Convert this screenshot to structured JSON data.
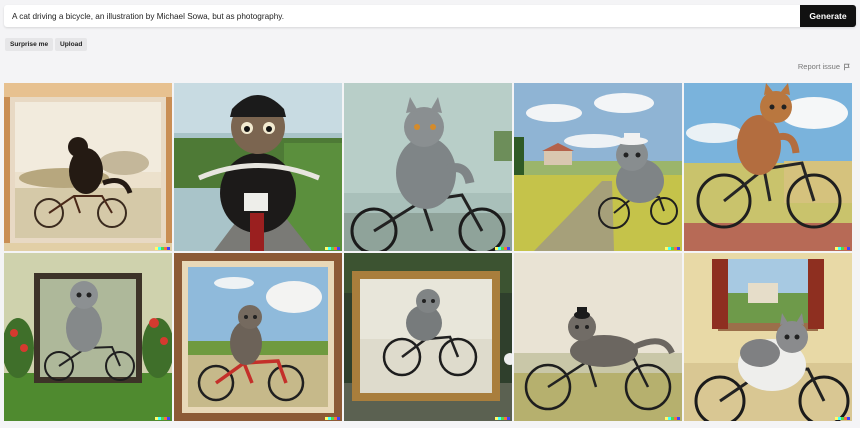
{
  "prompt": {
    "text": "A cat driving a bicycle, an illustration by Michael Sowa, but as photography."
  },
  "generate_label": "Generate",
  "actions": {
    "surprise_label": "Surprise me",
    "upload_label": "Upload"
  },
  "report_label": "Report issue",
  "signature_colors": [
    "#ffff66",
    "#42ffff",
    "#51da4c",
    "#ff6e3c",
    "#3c46ff"
  ],
  "icons": {
    "report": "flag-icon",
    "signature": "signature-icon"
  }
}
